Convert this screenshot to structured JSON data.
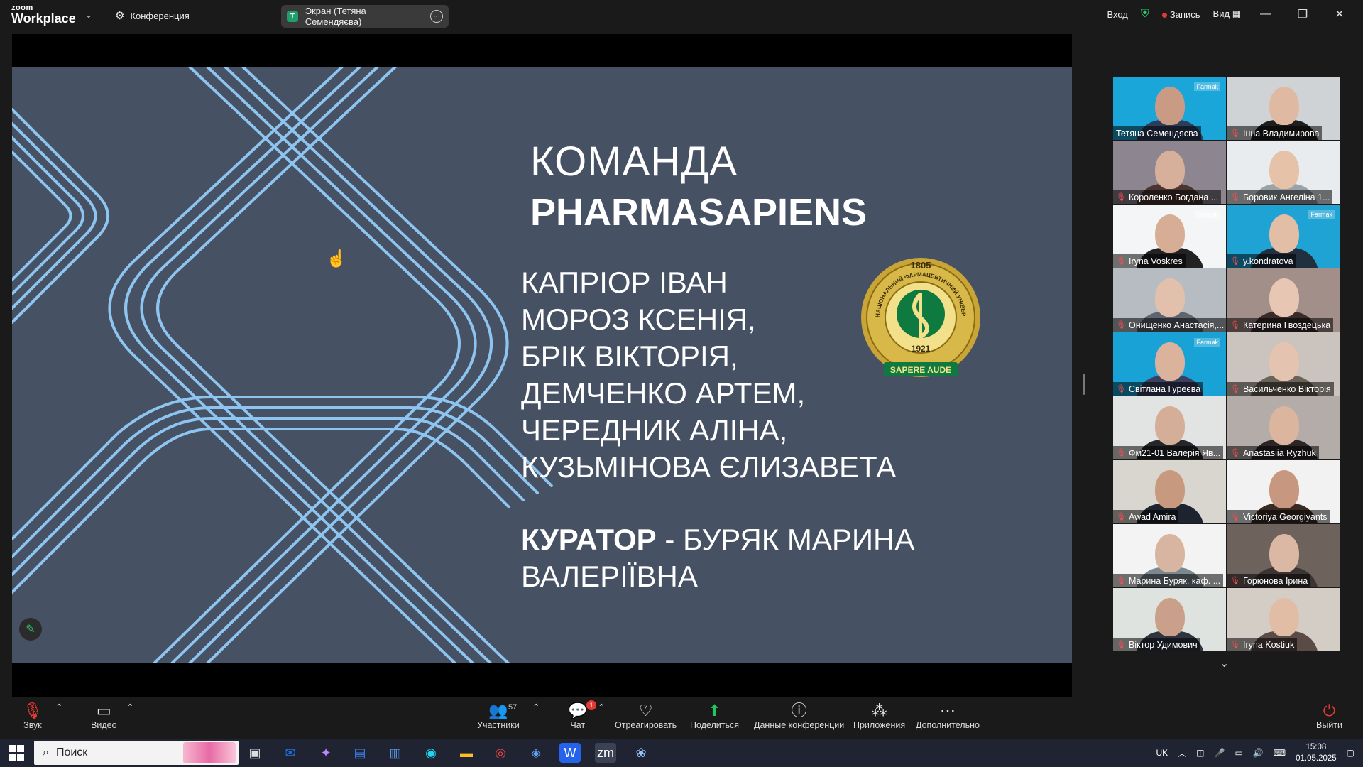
{
  "app": {
    "brand_top": "zoom",
    "brand_main": "Workplace",
    "conference_label": "Конференция",
    "screen_tab_initial": "T",
    "screen_tab_label": "Экран (Тетяна Семендяєва)",
    "login_label": "Вход",
    "record_label": "Запись",
    "view_label": "Вид"
  },
  "slide": {
    "title_line1": "КОМАНДА",
    "title_line2": "PHARMASAPIENS",
    "members": [
      "КАПРІОР ІВАН",
      "МОРОЗ КСЕНІЯ,",
      "БРІК ВІКТОРІЯ,",
      "ДЕМЧЕНКО АРТЕМ,",
      "ЧЕРЕДНИК АЛІНА,",
      "КУЗЬМІНОВА ЄЛИЗАВЕТА"
    ],
    "curator_label": "КУРАТОР",
    "curator_name": " - БУРЯК МАРИНА ВАЛЕРІЇВНА",
    "seal_year": "1805",
    "seal_founded": "1921",
    "seal_motto": "SAPERE AUDE",
    "seal_ring_text": "НАЦІОНАЛЬНИЙ ФАРМАЦЕВТИЧНИЙ УНІВЕРСИТЕТ"
  },
  "gallery": {
    "participants": [
      {
        "name": "Тетяна Семендяєва",
        "muted": false,
        "active": true,
        "bg": "#1aa6d8",
        "skin": "#c99a84",
        "cloth": "#2e3c5c",
        "logo": "Farmak"
      },
      {
        "name": "Інна Владимирова",
        "muted": true,
        "active": false,
        "bg": "#cfd3d6",
        "skin": "#e0b9a3",
        "cloth": "#1e1e1e",
        "logo": ""
      },
      {
        "name": "Короленко Богдана ...",
        "muted": true,
        "active": false,
        "bg": "#8d8590",
        "skin": "#d7b09b",
        "cloth": "#4a3530",
        "logo": ""
      },
      {
        "name": "Боровик Ангеліна  1...",
        "muted": true,
        "active": false,
        "bg": "#e9ecee",
        "skin": "#e5c2a8",
        "cloth": "#9aa3a8",
        "logo": ""
      },
      {
        "name": "Iryna Voskres",
        "muted": true,
        "active": false,
        "bg": "#f4f5f6",
        "skin": "#d8ad95",
        "cloth": "#222222",
        "logo": "Farmak"
      },
      {
        "name": "y.kondratova",
        "muted": true,
        "active": false,
        "bg": "#1ea3d4",
        "skin": "#e3bea6",
        "cloth": "#20303e",
        "logo": "Farmak"
      },
      {
        "name": "Онищенко Анастасія,...",
        "muted": true,
        "active": false,
        "bg": "#b7bcc2",
        "skin": "#e2c0ab",
        "cloth": "#5d6670",
        "logo": ""
      },
      {
        "name": "Катерина Гвоздецька",
        "muted": true,
        "active": false,
        "bg": "#a28f8a",
        "skin": "#e8c6b4",
        "cloth": "#3a2b2b",
        "logo": ""
      },
      {
        "name": "Світлана Гуреєва",
        "muted": true,
        "active": false,
        "bg": "#19a2d5",
        "skin": "#dbb39d",
        "cloth": "#3b3f60",
        "logo": "Farmak"
      },
      {
        "name": "Васильченко Вікторія",
        "muted": true,
        "active": false,
        "bg": "#cbc3bd",
        "skin": "#e4c4b0",
        "cloth": "#6c6258",
        "logo": ""
      },
      {
        "name": "Фм21-01 Валерія Яв...",
        "muted": true,
        "active": false,
        "bg": "#e2e4e3",
        "skin": "#d5ae98",
        "cloth": "#24262c",
        "logo": ""
      },
      {
        "name": "Anastasiia Ryzhuk",
        "muted": true,
        "active": false,
        "bg": "#b3aca8",
        "skin": "#dcb59f",
        "cloth": "#2b2526",
        "logo": ""
      },
      {
        "name": "Awad Amira",
        "muted": true,
        "active": false,
        "bg": "#d9d6cf",
        "skin": "#c79a80",
        "cloth": "#1d2430",
        "logo": ""
      },
      {
        "name": "Victoriya Georgiyants",
        "muted": true,
        "active": false,
        "bg": "#f2f2f2",
        "skin": "#c89780",
        "cloth": "#3a2a24",
        "logo": ""
      },
      {
        "name": "Марина Буряк, каф. ...",
        "muted": true,
        "active": false,
        "bg": "#f3f3f3",
        "skin": "#d8b5a0",
        "cloth": "#7c8890",
        "logo": ""
      },
      {
        "name": "Горюнова Ірина",
        "muted": true,
        "active": false,
        "bg": "#6d625c",
        "skin": "#dab8a3",
        "cloth": "#3b3432",
        "logo": ""
      },
      {
        "name": "Віктор Удимович",
        "muted": true,
        "active": false,
        "bg": "#dfe3e0",
        "skin": "#caa08a",
        "cloth": "#2e3440",
        "logo": ""
      },
      {
        "name": "Iryna Kostiuk",
        "muted": true,
        "active": false,
        "bg": "#d3cdc5",
        "skin": "#e1bda6",
        "cloth": "#5b4b46",
        "logo": ""
      }
    ]
  },
  "toolbar": {
    "audio": "Звук",
    "video": "Видео",
    "participants": "Участники",
    "participants_count": "57",
    "chat": "Чат",
    "chat_badge": "1",
    "react": "Отреагировать",
    "share": "Поделиться",
    "info": "Данные конференции",
    "apps": "Приложения",
    "more": "Дополнительно",
    "exit": "Выйти"
  },
  "taskbar": {
    "search_placeholder": "Поиск",
    "lang": "UK",
    "time": "15:08",
    "date": "01.05.2025"
  },
  "colors": {
    "slide_bg": "#475164",
    "slide_lines": "#8ec5f0",
    "active_border": "#3be3b3",
    "record_dot": "#e53935",
    "share_green": "#22c55e"
  }
}
